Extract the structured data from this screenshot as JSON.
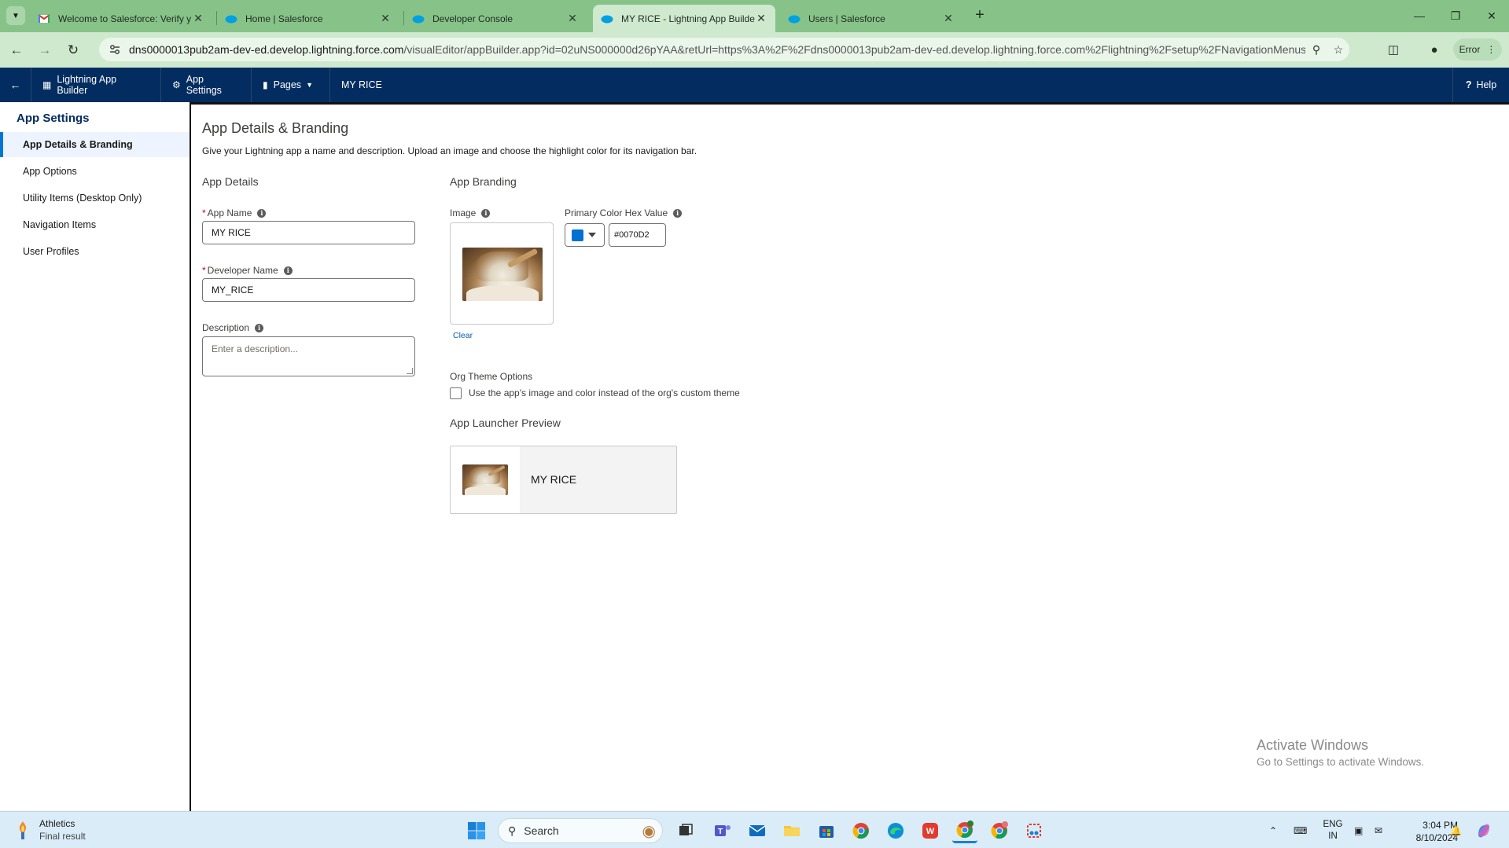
{
  "browser": {
    "tabs": [
      {
        "title": "Welcome to Salesforce: Verify y",
        "icon": "gmail-icon",
        "active": false
      },
      {
        "title": "Home | Salesforce",
        "icon": "salesforce-icon",
        "active": false
      },
      {
        "title": "Developer Console",
        "icon": "salesforce-icon",
        "active": false
      },
      {
        "title": "MY RICE - Lightning App Builde",
        "icon": "salesforce-icon",
        "active": true
      },
      {
        "title": "Users | Salesforce",
        "icon": "salesforce-icon",
        "active": false
      }
    ],
    "url_host": "dns0000013pub2am-dev-ed.develop.lightning.force.com",
    "url_path": "/visualEditor/appBuilder.app?id=02uNS000000d26pYAA&retUrl=https%3A%2F%2Fdns0000013pub2am-dev-ed.develop.lightning.force.com%2Flightning%2Fsetup%2FNavigationMenus%...",
    "profile_label": "Error"
  },
  "header": {
    "builder_label": "Lightning App Builder",
    "settings_label": "App Settings",
    "pages_label": "Pages",
    "app_label": "MY RICE",
    "help_label": "Help"
  },
  "sidebar": {
    "title": "App Settings",
    "items": [
      {
        "label": "App Details & Branding",
        "active": true
      },
      {
        "label": "App Options",
        "active": false
      },
      {
        "label": "Utility Items (Desktop Only)",
        "active": false
      },
      {
        "label": "Navigation Items",
        "active": false
      },
      {
        "label": "User Profiles",
        "active": false
      }
    ]
  },
  "main": {
    "title": "App Details & Branding",
    "description": "Give your Lightning app a name and description. Upload an image and choose the highlight color for its navigation bar.",
    "details": {
      "section_title": "App Details",
      "app_name_label": "App Name",
      "app_name_value": "MY RICE",
      "dev_name_label": "Developer Name",
      "dev_name_value": "MY_RICE",
      "description_label": "Description",
      "description_placeholder": "Enter a description..."
    },
    "branding": {
      "section_title": "App Branding",
      "image_label": "Image",
      "clear_label": "Clear",
      "color_label": "Primary Color Hex Value",
      "color_value": "#0070D2",
      "org_theme_label": "Org Theme Options",
      "org_theme_checkbox_label": "Use the app's image and color instead of the org's custom theme",
      "org_theme_checked": false,
      "preview_title": "App Launcher Preview",
      "preview_app_name": "MY RICE"
    }
  },
  "watermark": {
    "line1": "Activate Windows",
    "line2": "Go to Settings to activate Windows."
  },
  "taskbar": {
    "weather_title": "Athletics",
    "weather_sub": "Final result",
    "search_label": "Search",
    "lang_line1": "ENG",
    "lang_line2": "IN",
    "time": "3:04 PM",
    "date": "8/10/2024"
  },
  "colors": {
    "header_bg": "#032d60",
    "accent": "#0176d3",
    "primary_color": "#0070D2",
    "browser_frame": "#87c389"
  }
}
